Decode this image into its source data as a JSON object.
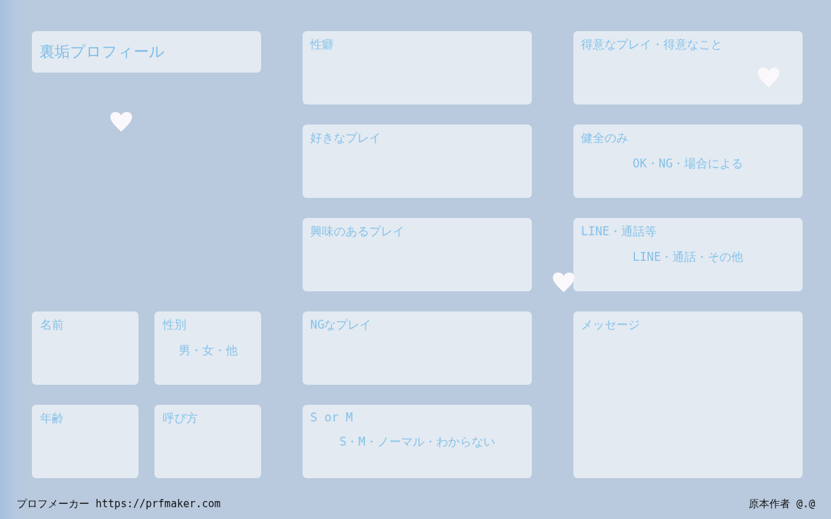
{
  "header": {
    "title": "裏垢プロフィール"
  },
  "basics": [
    {
      "label": "名前"
    },
    {
      "label": "性別",
      "options": "男・女・他"
    },
    {
      "label": "年齢"
    },
    {
      "label": "呼び方"
    }
  ],
  "middle": [
    {
      "label": "性癖"
    },
    {
      "label": "好きなプレイ"
    },
    {
      "label": "興味のあるプレイ"
    },
    {
      "label": "NGなプレイ"
    },
    {
      "label": "S or M",
      "options": "S・M・ノーマル・わからない"
    }
  ],
  "right": [
    {
      "label": "得意なプレイ・得意なこと"
    },
    {
      "label": "健全のみ",
      "options": "OK・NG・場合による"
    },
    {
      "label": "LINE・通話等",
      "options": "LINE・通話・その他"
    },
    {
      "label": "メッセージ"
    }
  ],
  "footer": {
    "site": "プロフメーカー https://prfmaker.com",
    "author": "原本作者 @.@"
  }
}
